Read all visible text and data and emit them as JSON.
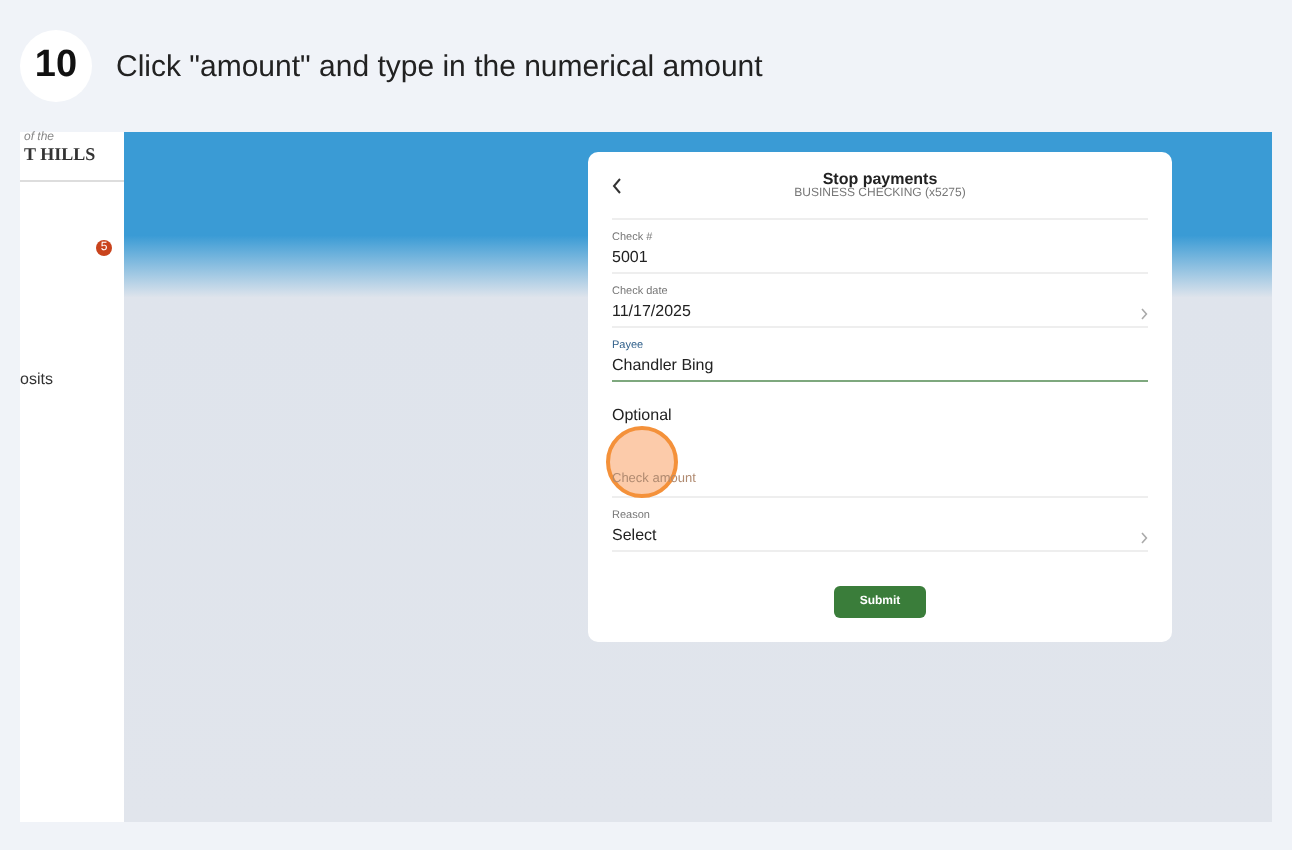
{
  "step": {
    "number": "10",
    "instruction": "Click \"amount\" and type in the numerical amount"
  },
  "sidebar": {
    "logo_top": "of the",
    "logo_bottom": "T HILLS",
    "badge": "5",
    "item": "osits"
  },
  "card": {
    "title": "Stop payments",
    "subtitle": "BUSINESS CHECKING (x5275)",
    "fields": [
      {
        "kind": "text",
        "label": "Check #",
        "value": "5001",
        "focused": false
      },
      {
        "kind": "select",
        "label": "Check date",
        "value": "11/17/2025",
        "focused": false
      },
      {
        "kind": "text",
        "label": "Payee",
        "value": "Chandler Bing",
        "focused": true
      }
    ],
    "section": "Optional",
    "amount": {
      "placeholder": "Check amount",
      "highlighted": true
    },
    "reason": {
      "label": "Reason",
      "value": "Select"
    },
    "submit": "Submit"
  }
}
